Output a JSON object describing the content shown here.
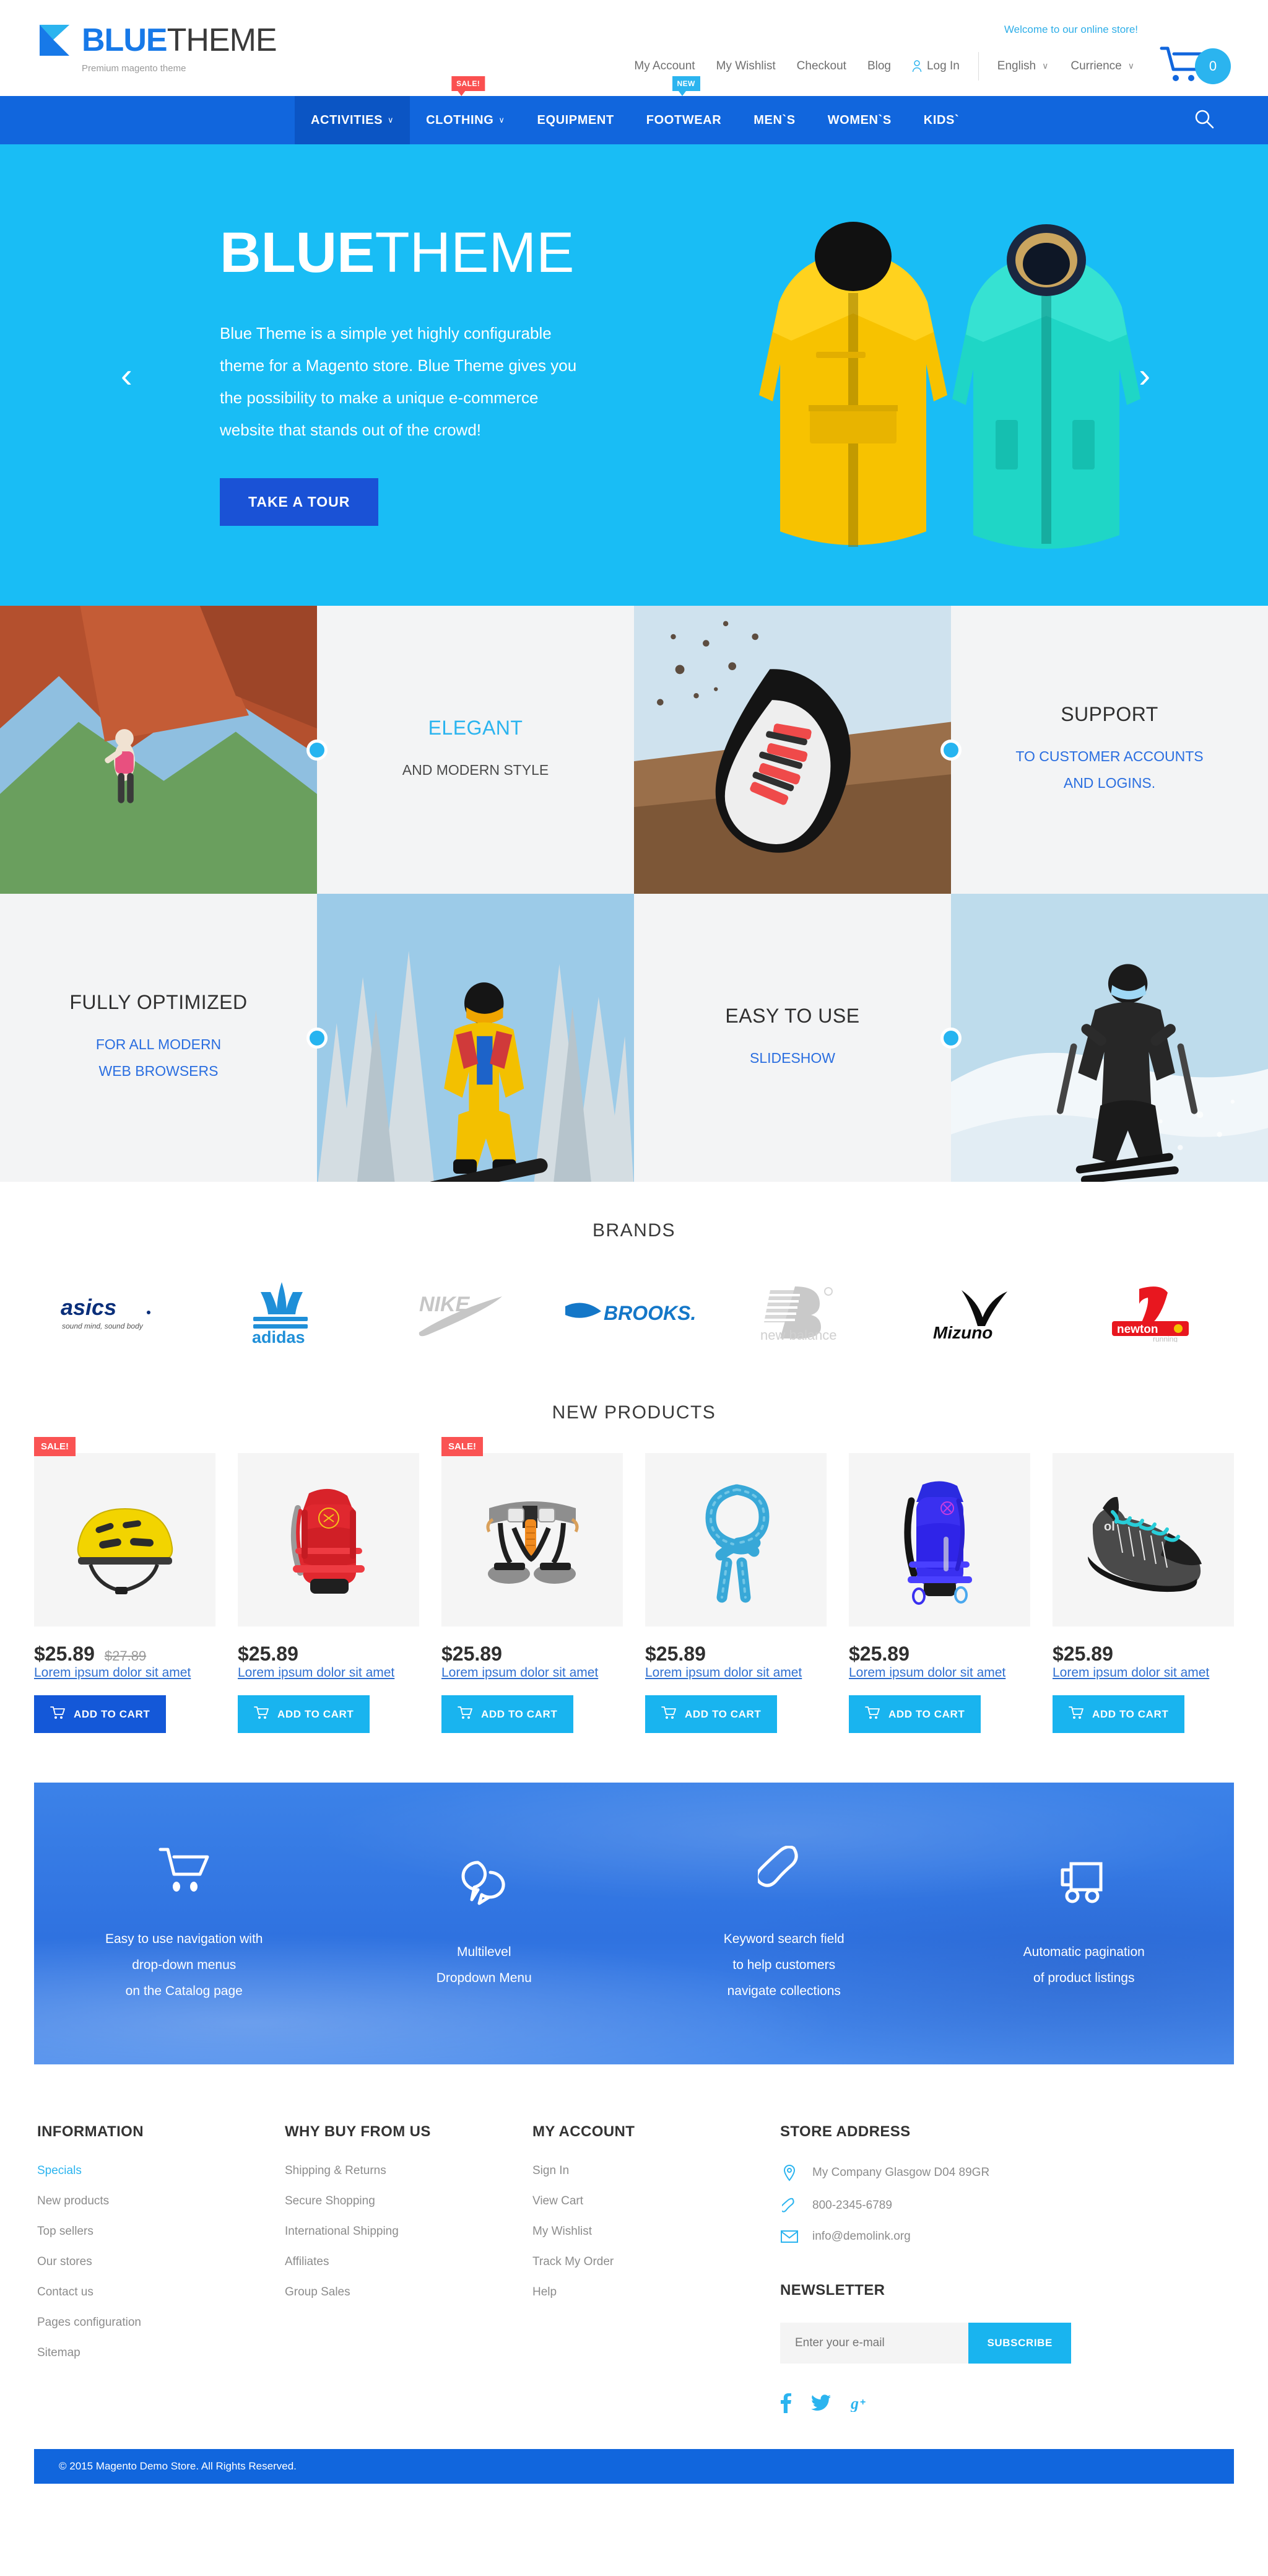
{
  "header": {
    "logo": {
      "part1": "BLUE",
      "part2": "THEME",
      "tagline": "Premium magento theme"
    },
    "welcome": "Welcome to our online store!",
    "util_links": [
      {
        "label": "My Account"
      },
      {
        "label": "My Wishlist"
      },
      {
        "label": "Checkout"
      },
      {
        "label": "Blog"
      },
      {
        "label": "Log In"
      }
    ],
    "language": {
      "label": "English",
      "chevron": "∨"
    },
    "currency": {
      "label": "Currience",
      "chevron": "∨"
    },
    "cart_count": "0"
  },
  "nav": {
    "items": [
      {
        "label": "ACTIVITIES",
        "chevron": "∨",
        "badge": null,
        "active": true
      },
      {
        "label": "CLOTHING",
        "chevron": "∨",
        "badge": "SALE!",
        "badge_type": "sale"
      },
      {
        "label": "EQUIPMENT",
        "chevron": "",
        "badge": null
      },
      {
        "label": "FOOTWEAR",
        "chevron": "",
        "badge": "NEW",
        "badge_type": "new"
      },
      {
        "label": "MEN`S",
        "chevron": "",
        "badge": null
      },
      {
        "label": "WOMEN`S",
        "chevron": "",
        "badge": null
      },
      {
        "label": "KIDS`",
        "chevron": "",
        "badge": null
      }
    ]
  },
  "hero": {
    "title_bold": "BLUE",
    "title_light": "THEME",
    "description": "Blue Theme is a simple yet highly configurable theme for a Magento store. Blue Theme gives you the possibility to make a unique e-commerce website that stands out of the crowd!",
    "button": "TAKE A TOUR",
    "prev_arrow": "‹",
    "next_arrow": "›"
  },
  "features": {
    "row1": [
      {
        "type": "image",
        "name": "climbing-photo"
      },
      {
        "type": "text",
        "title": "ELEGANT",
        "title_accent": true,
        "subtitle": "AND MODERN STYLE",
        "subtitle_accent": false
      },
      {
        "type": "image",
        "name": "running-shoe-photo"
      },
      {
        "type": "text",
        "title": "SUPPORT",
        "title_accent": false,
        "subtitle": "TO CUSTOMER ACCOUNTS\nAND LOGINS.",
        "subtitle_accent": true
      }
    ],
    "row2": [
      {
        "type": "text",
        "title": "FULLY OPTIMIZED",
        "title_accent": false,
        "subtitle": "FOR ALL MODERN\nWEB BROWSERS",
        "subtitle_accent": true
      },
      {
        "type": "image",
        "name": "snowboarder-photo"
      },
      {
        "type": "text",
        "title": "EASY TO USE",
        "title_accent": false,
        "subtitle": "SLIDESHOW",
        "subtitle_accent": true
      },
      {
        "type": "image",
        "name": "skier-photo"
      }
    ]
  },
  "brands": {
    "title": "BRANDS",
    "items": [
      {
        "name": "asics",
        "tagline": "sound mind, sound body"
      },
      {
        "name": "adidas"
      },
      {
        "name": "NIKE"
      },
      {
        "name": "BROOKS"
      },
      {
        "name": "new balance"
      },
      {
        "name": "Mizuno"
      },
      {
        "name": "newton",
        "tagline": "running"
      }
    ]
  },
  "products": {
    "title": "NEW PRODUCTS",
    "add_to_cart_label": "ADD TO CART",
    "items": [
      {
        "badge": "SALE!",
        "price": "$25.89",
        "old_price": "$27.89",
        "name": "Lorem ipsum dolor sit amet",
        "image": "yellow-helmet",
        "button_hover": true
      },
      {
        "badge": null,
        "price": "$25.89",
        "old_price": null,
        "name": "Lorem ipsum dolor sit amet",
        "image": "red-backpack",
        "button_hover": false
      },
      {
        "badge": "SALE!",
        "price": "$25.89",
        "old_price": null,
        "name": "Lorem ipsum dolor sit amet",
        "image": "climbing-harness",
        "button_hover": false
      },
      {
        "badge": null,
        "price": "$25.89",
        "old_price": null,
        "name": "Lorem ipsum dolor sit amet",
        "image": "blue-rope",
        "button_hover": false
      },
      {
        "badge": null,
        "price": "$25.89",
        "old_price": null,
        "name": "Lorem ipsum dolor sit amet",
        "image": "blue-backpack",
        "button_hover": false
      },
      {
        "badge": null,
        "price": "$25.89",
        "old_price": null,
        "name": "Lorem ipsum dolor sit amet",
        "image": "climbing-shoe",
        "button_hover": false
      }
    ]
  },
  "promo": {
    "columns": [
      {
        "icon": "cart-icon",
        "text": "Easy to use navigation with\ndrop-down menus\non the Catalog page"
      },
      {
        "icon": "chat-bubbles-icon",
        "text": "Multilevel\nDropdown Menu"
      },
      {
        "icon": "phone-icon",
        "text": "Keyword search field\nto help customers\nnavigate collections"
      },
      {
        "icon": "truck-icon",
        "text": "Automatic pagination\nof product listings"
      }
    ]
  },
  "footer": {
    "information": {
      "title": "INFORMATION",
      "links": [
        {
          "label": "Specials",
          "active": true
        },
        {
          "label": "New products",
          "active": false
        },
        {
          "label": "Top sellers",
          "active": false
        },
        {
          "label": "Our stores",
          "active": false
        },
        {
          "label": "Contact us",
          "active": false
        },
        {
          "label": "Pages configuration",
          "active": false
        },
        {
          "label": "Sitemap",
          "active": false
        }
      ]
    },
    "why_buy": {
      "title": "WHY BUY FROM US",
      "links": [
        {
          "label": "Shipping & Returns"
        },
        {
          "label": "Secure Shopping"
        },
        {
          "label": "International Shipping"
        },
        {
          "label": "Affiliates"
        },
        {
          "label": "Group Sales"
        }
      ]
    },
    "my_account": {
      "title": "MY ACCOUNT",
      "links": [
        {
          "label": "Sign In"
        },
        {
          "label": "View Cart"
        },
        {
          "label": "My Wishlist"
        },
        {
          "label": "Track My Order"
        },
        {
          "label": "Help"
        }
      ]
    },
    "store_address": {
      "title": "STORE ADDRESS",
      "address": "My Company Glasgow D04 89GR",
      "phone": "800-2345-6789",
      "email": "info@demolink.org"
    },
    "newsletter": {
      "title": "NEWSLETTER",
      "placeholder": "Enter your e-mail",
      "value": "",
      "button": "SUBSCRIBE"
    },
    "social": [
      {
        "name": "facebook",
        "glyph": "f"
      },
      {
        "name": "twitter",
        "glyph": "🐦"
      },
      {
        "name": "google-plus",
        "glyph": "g+"
      }
    ],
    "copyright": "© 2015 Magento Demo Store. All Rights Reserved."
  },
  "colors": {
    "primary_blue": "#1166dd",
    "light_blue": "#19b4ef",
    "hero_blue": "#19bdf5",
    "sale_red": "#fa5050",
    "link_blue": "#2f6fd0"
  }
}
